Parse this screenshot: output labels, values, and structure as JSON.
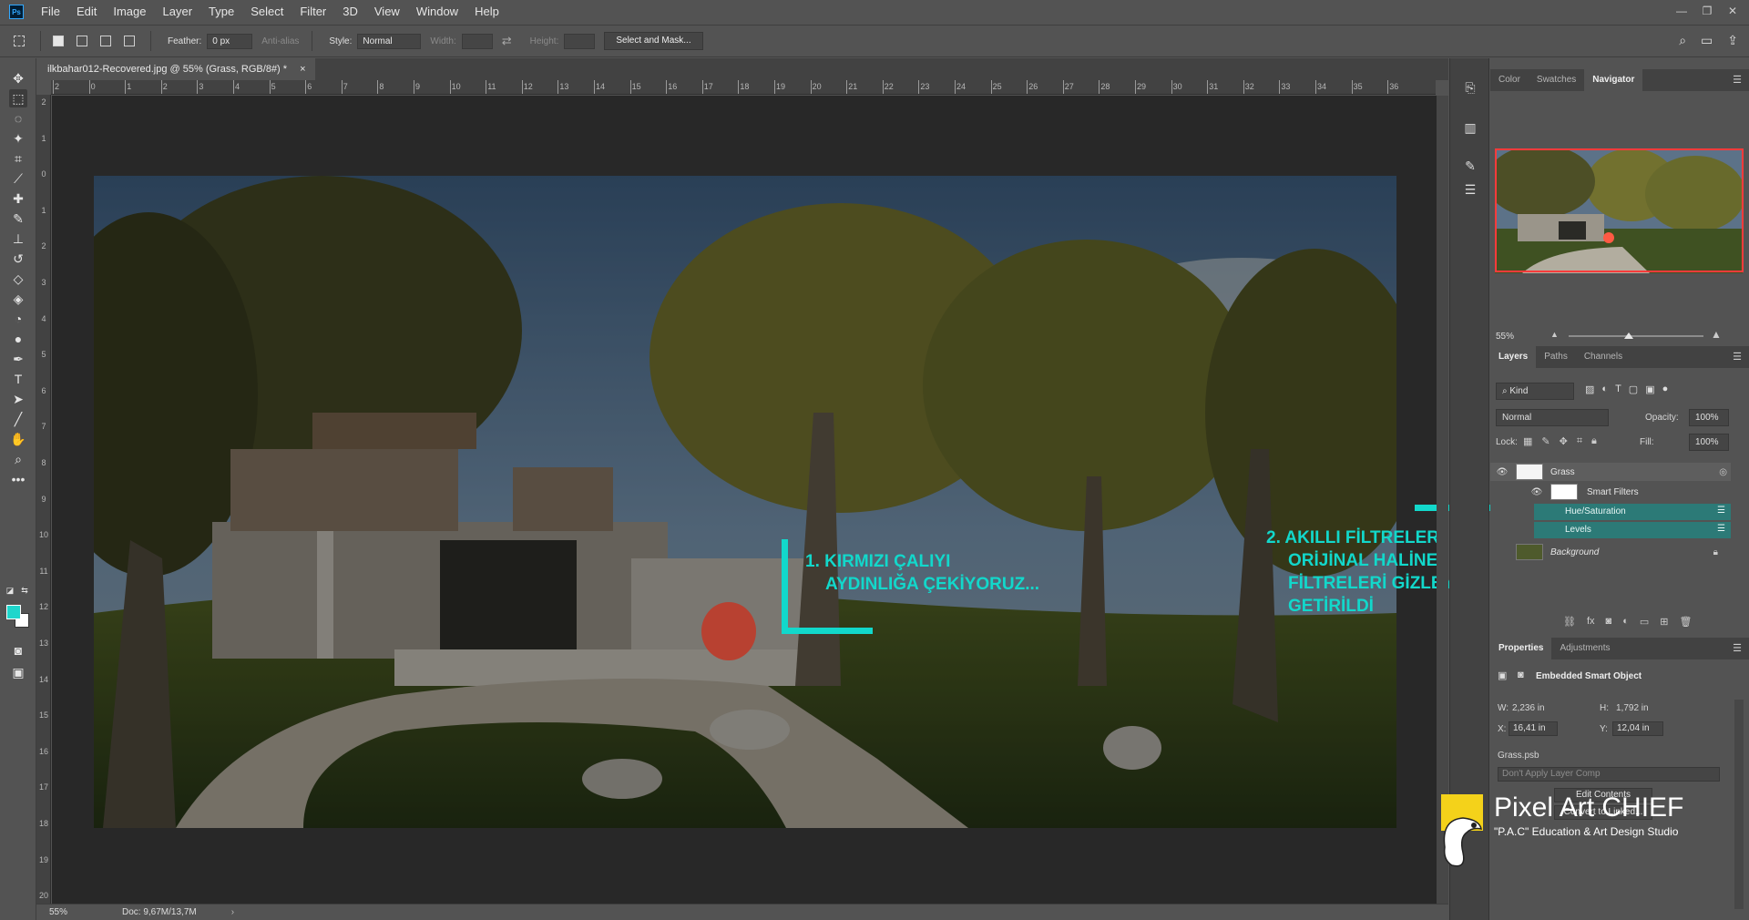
{
  "menubar": {
    "logo": "Ps",
    "items": [
      "File",
      "Edit",
      "Image",
      "Layer",
      "Type",
      "Select",
      "Filter",
      "3D",
      "View",
      "Window",
      "Help"
    ]
  },
  "options": {
    "feather_label": "Feather:",
    "feather_value": "0 px",
    "antialias_label": "Anti-alias",
    "style_label": "Style:",
    "style_value": "Normal",
    "width_label": "Width:",
    "height_label": "Height:",
    "select_mask_label": "Select and Mask..."
  },
  "document": {
    "tab_title": "ilkbahar012-Recovered.jpg @ 55% (Grass, RGB/8#) *",
    "close": "×"
  },
  "ruler_h": [
    "2",
    "0",
    "1",
    "2",
    "3",
    "4",
    "5",
    "6",
    "7",
    "8",
    "9",
    "10",
    "11",
    "12",
    "13",
    "14",
    "15",
    "16",
    "17",
    "18",
    "19",
    "20",
    "21",
    "22",
    "23",
    "24",
    "25",
    "26",
    "27",
    "28",
    "29",
    "30",
    "31",
    "32",
    "33",
    "34",
    "35",
    "36"
  ],
  "ruler_v": [
    "2",
    "1",
    "0",
    "1",
    "2",
    "3",
    "4",
    "5",
    "6",
    "7",
    "8",
    "9",
    "10",
    "11",
    "12",
    "13",
    "14",
    "15",
    "16",
    "17",
    "18",
    "19",
    "20"
  ],
  "annotations": {
    "note1_line1": "1. KIRMIZI ÇALIYI",
    "note1_line2": "AYDINLIĞA ÇEKİYORUZ...",
    "note2_line1": "2. AKILLI FİLTRELER",
    "note2_line2": "ORİJİNAL HALİNE",
    "note2_line3": "FİLTRELERİ GİZLEYEREK",
    "note2_line4": "GETİRİLDİ"
  },
  "status": {
    "zoom": "55%",
    "doc": "Doc: 9,67M/13,7M"
  },
  "panels": {
    "top_tabs": [
      "Color",
      "Swatches",
      "Navigator"
    ],
    "navigator_zoom": "55%",
    "layer_tabs": [
      "Layers",
      "Paths",
      "Channels"
    ],
    "kind_label": "Kind",
    "blend_mode": "Normal",
    "opacity_label": "Opacity:",
    "opacity_value": "100%",
    "lock_label": "Lock:",
    "fill_label": "Fill:",
    "fill_value": "100%",
    "layers": {
      "grass": "Grass",
      "smart_filters": "Smart Filters",
      "hue_sat": "Hue/Saturation",
      "levels": "Levels",
      "background": "Background"
    },
    "prop_tabs": [
      "Properties",
      "Adjustments"
    ],
    "prop_title": "Embedded Smart Object",
    "w_label": "W:",
    "w_value": "2,236 in",
    "h_label": "H:",
    "h_value": "1,792 in",
    "x_label": "X:",
    "x_value": "16,41 in",
    "y_label": "Y:",
    "y_value": "12,04 in",
    "file_name": "Grass.psb",
    "layer_comp_placeholder": "Don't Apply Layer Comp",
    "edit_contents": "Edit Contents",
    "convert_linked": "Convert to Linked..."
  },
  "watermark": {
    "title": "Pixel Art CHIEF",
    "subtitle": "\"P.A.C\" Education & Art Design Studio"
  },
  "colors": {
    "foreground": "#1fd6cc",
    "background": "#ffffff",
    "annotation": "#12d8cb"
  }
}
